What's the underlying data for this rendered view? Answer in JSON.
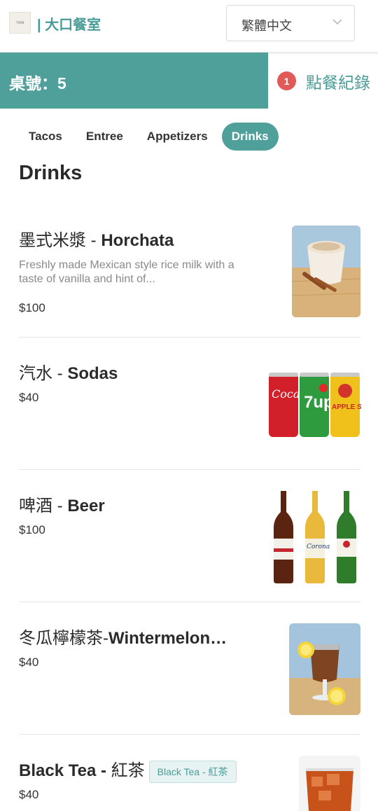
{
  "header": {
    "logo_text": "TIAN",
    "brand": "| 大口餐室",
    "language": "繁體中文"
  },
  "table_bar": {
    "table_label": "桌號：5",
    "order_count": "1",
    "order_history": "點餐紀錄"
  },
  "tabs": [
    "Tacos",
    "Entree",
    "Appetizers",
    "Drinks"
  ],
  "active_tab": "Drinks",
  "section_title": "Drinks",
  "items": [
    {
      "name_zh": "墨式米漿 - ",
      "name_en": "Horchata",
      "description": "Freshly made Mexican style rice milk with a taste of vanilla and hint of...",
      "price": "$100"
    },
    {
      "name_zh": "汽水 - ",
      "name_en": "Sodas",
      "price": "$40"
    },
    {
      "name_zh": "啤酒 - ",
      "name_en": "Beer",
      "price": "$100"
    },
    {
      "name_zh": "冬瓜檸檬茶-",
      "name_en": "Wintermelon…",
      "price": "$40"
    },
    {
      "name_en": "Black Tea - ",
      "name_zh": "紅茶",
      "tag": "Black Tea - 紅茶",
      "price": "$40"
    }
  ],
  "colors": {
    "accent": "#4f9f9b",
    "badge": "#e05a57"
  }
}
